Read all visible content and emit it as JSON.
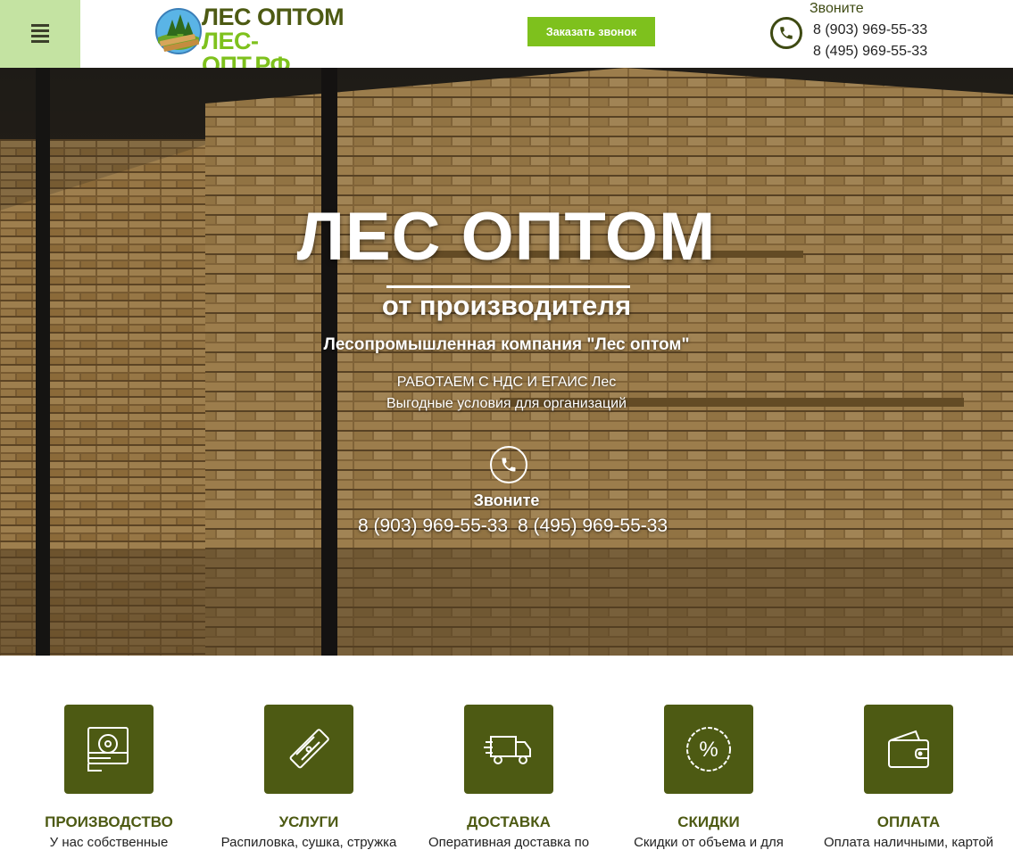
{
  "header": {
    "logo_line1": "ЛЕС ОПТОМ",
    "logo_line2": "ЛЕС-ОПТ.РФ",
    "callback_label": "Заказать звонок",
    "call_label": "Звоните",
    "phones": [
      "8 (903) 969-55-33",
      "8 (495) 969-55-33"
    ]
  },
  "hero": {
    "title": "ЛЕС ОПТОМ",
    "subtitle": "от производителя",
    "company": "Лесопромышленная компания \"Лес оптом\"",
    "line1": "РАБОТАЕМ С НДС И ЕГАИС Лес",
    "line2": "Выгодные условия для организаций",
    "call_label": "Звоните",
    "phones": [
      "8 (903) 969-55-33",
      "8 (495) 969-55-33"
    ]
  },
  "features": [
    {
      "icon": "saw-icon",
      "title": "ПРОИЗВОДСТВО",
      "desc": "У нас собственные"
    },
    {
      "icon": "plank-icon",
      "title": "УСЛУГИ",
      "desc": "Распиловка, сушка, стружка"
    },
    {
      "icon": "truck-icon",
      "title": "ДОСТАВКА",
      "desc": "Оперативная доставка по"
    },
    {
      "icon": "percent-icon",
      "title": "СКИДКИ",
      "desc": "Скидки от объема и для"
    },
    {
      "icon": "wallet-icon",
      "title": "ОПЛАТА",
      "desc": "Оплата наличными, картой"
    }
  ],
  "colors": {
    "brand_dark": "#4d5a13",
    "brand_green": "#7ec11d",
    "menu_bg": "#c4e3a2"
  }
}
